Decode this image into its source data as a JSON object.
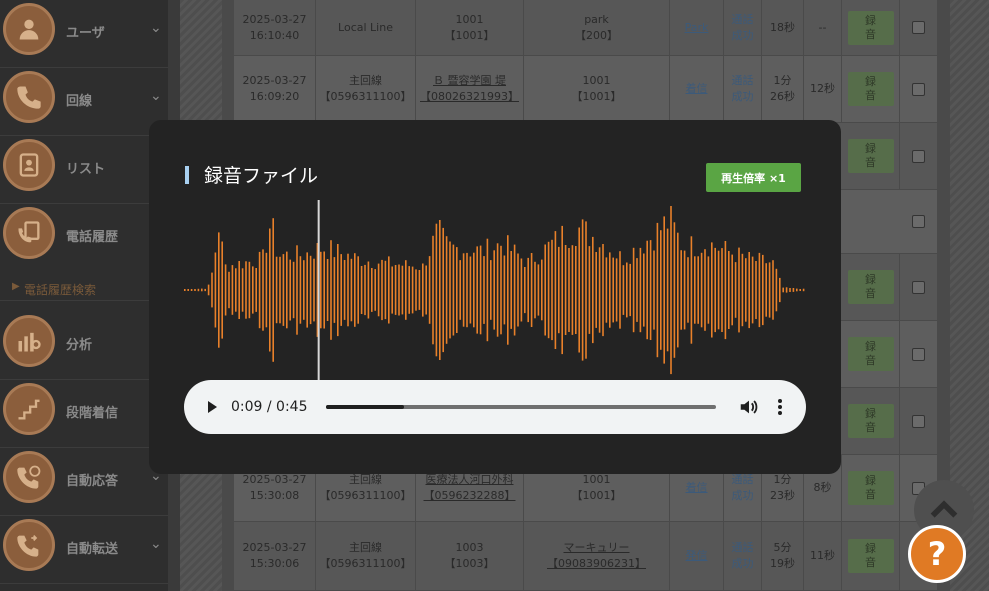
{
  "sidebar": {
    "items": [
      {
        "label": "ユーザ",
        "icon": "user-icon",
        "chevron": true
      },
      {
        "label": "回線",
        "icon": "phone-line-icon",
        "chevron": true
      },
      {
        "label": "リスト",
        "icon": "contact-list-icon",
        "chevron": false
      },
      {
        "label": "電話履歴",
        "icon": "call-history-icon",
        "chevron": false
      },
      {
        "label": "分析",
        "icon": "analytics-icon",
        "chevron": false
      },
      {
        "label": "段階着信",
        "icon": "stepped-incoming-icon",
        "chevron": false
      },
      {
        "label": "自動応答",
        "icon": "auto-answer-icon",
        "chevron": true
      },
      {
        "label": "自動転送",
        "icon": "auto-transfer-icon",
        "chevron": true
      }
    ],
    "submenu_label": "電話履歴検索"
  },
  "table": {
    "rows": [
      {
        "date": "2025-03-27",
        "time": "16:10:40",
        "line1": "Local Line",
        "line2": "",
        "from1": "1001",
        "from2": "【1001】",
        "to1": "park",
        "to2": "【200】",
        "direction": "Park",
        "status1": "通話",
        "status2": "成功",
        "dur1": "18秒",
        "dur2": "",
        "ring": "--",
        "rec1": "録",
        "rec2": "音"
      },
      {
        "date": "2025-03-27",
        "time": "16:09:20",
        "line1": "主回線",
        "line2": "【0596311100】",
        "from1": "Ｂ 暨容学園 堤",
        "from2": "【08026321993】",
        "to1": "1001",
        "to2": "【1001】",
        "direction": "着信",
        "status1": "通話",
        "status2": "成功",
        "dur1": "1分",
        "dur2": "26秒",
        "ring": "12秒",
        "rec1": "録",
        "rec2": "音"
      },
      {
        "date": "2025-03-27",
        "time": "15:30:08",
        "line1": "主回線",
        "line2": "【0596311100】",
        "from1": "医療法人河口外科",
        "from2": "【0596232288】",
        "to1": "1001",
        "to2": "【1001】",
        "direction": "着信",
        "status1": "通話",
        "status2": "成功",
        "dur1": "1分",
        "dur2": "23秒",
        "ring": "8秒",
        "rec1": "録",
        "rec2": "音"
      },
      {
        "date": "2025-03-27",
        "time": "15:30:06",
        "line1": "主回線",
        "line2": "【0596311100】",
        "from1": "1003",
        "from2": "【1003】",
        "to1": "マーキュリー",
        "to2": "【09083906231】",
        "direction": "発信",
        "status1": "通話",
        "status2": "成功",
        "dur1": "5分",
        "dur2": "19秒",
        "ring": "11秒",
        "rec1": "録",
        "rec2": "音"
      }
    ],
    "rec_label1": "録",
    "rec_label2": "音"
  },
  "modal": {
    "title": "録音ファイル",
    "speed_button": "再生倍率 ×1",
    "player": {
      "current_time": "0:09",
      "duration": "0:45",
      "time_display": "0:09 / 0:45",
      "progress_fraction": 0.2
    },
    "playhead_fraction": 0.219
  },
  "help_button": "?",
  "colors": {
    "waveform": "#e8802a",
    "speed_button": "#5aa544",
    "title_accent": "#a8d0f0",
    "help_button": "#e07a24"
  }
}
